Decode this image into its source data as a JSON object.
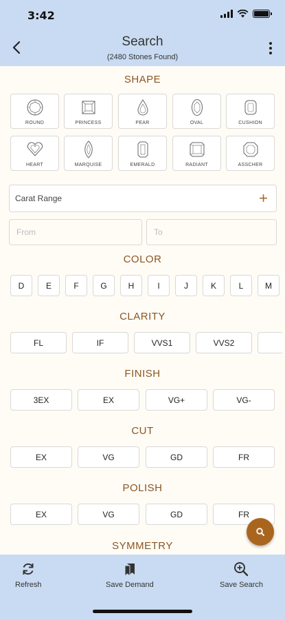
{
  "status": {
    "time": "3:42"
  },
  "header": {
    "title": "Search",
    "subtitle": "(2480 Stones Found)"
  },
  "shape": {
    "title": "SHAPE",
    "items": [
      {
        "label": "ROUND",
        "icon": "round-icon"
      },
      {
        "label": "PRINCESS",
        "icon": "princess-icon"
      },
      {
        "label": "PEAR",
        "icon": "pear-icon"
      },
      {
        "label": "OVAL",
        "icon": "oval-icon"
      },
      {
        "label": "CUSHION",
        "icon": "cushion-icon"
      },
      {
        "label": "HEART",
        "icon": "heart-icon"
      },
      {
        "label": "MARQUISE",
        "icon": "marquise-icon"
      },
      {
        "label": "EMERALD",
        "icon": "emerald-icon"
      },
      {
        "label": "RADIANT",
        "icon": "radiant-icon"
      },
      {
        "label": "ASSCHER",
        "icon": "asscher-icon"
      }
    ]
  },
  "carat": {
    "label": "Carat Range",
    "from_placeholder": "From",
    "to_placeholder": "To"
  },
  "color": {
    "title": "COLOR",
    "items": [
      "D",
      "E",
      "F",
      "G",
      "H",
      "I",
      "J",
      "K",
      "L",
      "M"
    ]
  },
  "clarity": {
    "title": "CLARITY",
    "items": [
      "FL",
      "IF",
      "VVS1",
      "VVS2"
    ]
  },
  "finish": {
    "title": "FINISH",
    "items": [
      "3EX",
      "EX",
      "VG+",
      "VG-"
    ]
  },
  "cut": {
    "title": "CUT",
    "items": [
      "EX",
      "VG",
      "GD",
      "FR"
    ]
  },
  "polish": {
    "title": "POLISH",
    "items": [
      "EX",
      "VG",
      "GD",
      "FR"
    ]
  },
  "symmetry": {
    "title": "SYMMETRY"
  },
  "bottom": {
    "refresh": "Refresh",
    "save_demand": "Save Demand",
    "save_search": "Save Search"
  },
  "colors": {
    "header_bg": "#c9dbf2",
    "accent": "#a9651e",
    "section_title": "#8a5520"
  }
}
